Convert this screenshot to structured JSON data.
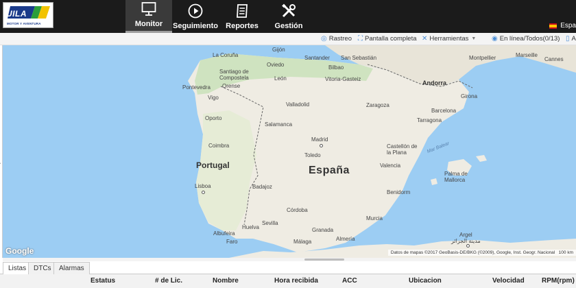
{
  "logo": {
    "word": "UILA",
    "tagline": "MOTOR Y AVENTURA",
    "colors": {
      "blue": "#1a3a8a",
      "green": "#2c9e3a",
      "yellow": "#f2c300"
    }
  },
  "nav": [
    {
      "label": "Monitor",
      "icon": "monitor-icon",
      "active": true
    },
    {
      "label": "Seguimiento",
      "icon": "play-circle-icon",
      "active": false
    },
    {
      "label": "Reportes",
      "icon": "document-icon",
      "active": false
    },
    {
      "label": "Gestión",
      "icon": "tools-icon",
      "active": false
    }
  ],
  "language": {
    "label": "Espa",
    "flag": "spain-flag-icon"
  },
  "toolbar": {
    "rastreo": "Rastreo",
    "pantalla": "Pantalla completa",
    "herramientas": "Herramientas",
    "online": "En línea/Todos(0/13)",
    "extra": "A"
  },
  "map": {
    "countries": {
      "spain": "España",
      "portugal": "Portugal",
      "andorra": "Andorra"
    },
    "sea": "Mar Balear",
    "cities": {
      "coruna": "La Coruña",
      "gijon": "Gijón",
      "oviedo": "Oviedo",
      "santander": "Santander",
      "sansebastian": "San Sebastián",
      "bilbao": "Bilbao",
      "vitoria": "Vitoria-Gasteiz",
      "santiago": "Santiago de Compostela",
      "pontevedra": "Pontevedra",
      "orense": "Orense",
      "vigo": "Vigo",
      "leon": "León",
      "valladolid": "Valladolid",
      "zaragoza": "Zaragoza",
      "girona": "Girona",
      "barcelona": "Barcelona",
      "tarragona": "Tarragona",
      "porto": "Oporto",
      "salamanca": "Salamanca",
      "madrid": "Madrid",
      "toledo": "Toledo",
      "coimbra": "Coimbra",
      "castellon": "Castellón de la Plana",
      "valencia": "Valencia",
      "lisboa": "Lisboa",
      "badajoz": "Badajoz",
      "palma": "Palma de Mallorca",
      "benidorm": "Benidorm",
      "cordoba": "Córdoba",
      "murcia": "Murcia",
      "sevilla": "Sevilla",
      "huelva": "Huelva",
      "granada": "Granada",
      "albufeira": "Albufeira",
      "faro": "Faro",
      "malaga": "Málaga",
      "almeria": "Almería",
      "argel": "Argel",
      "argel_ar": "مدينة الجزائر",
      "montpellier": "Montpellier",
      "marseille": "Marseille",
      "cannes": "Cannes"
    },
    "google": "Google",
    "attribution": "Datos de mapas ©2017 GeoBasis-DE/BKG (©2009), Google, Inst. Geogr. Nacional",
    "scale": "100 km"
  },
  "bottom_tabs": [
    {
      "label": "Listas",
      "active": true
    },
    {
      "label": "DTCs",
      "active": false
    },
    {
      "label": "Alarmas",
      "active": false
    }
  ],
  "table": {
    "headers": [
      "Estatus",
      "# de Lic.",
      "Nombre",
      "Hora recibida",
      "ACC",
      "Ubicacion",
      "Velocidad",
      "RPM(rpm)"
    ]
  }
}
